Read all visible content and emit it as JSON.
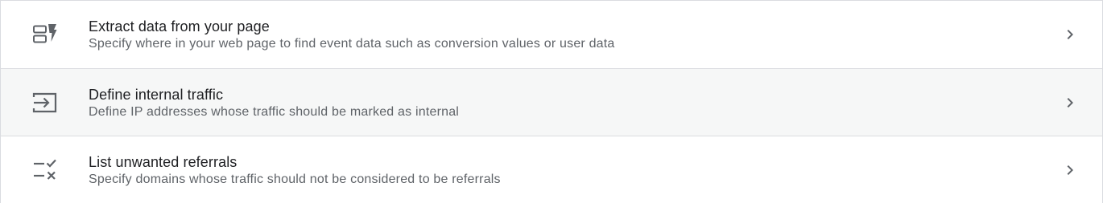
{
  "colors": {
    "border": "#dadce0",
    "row_hover_bg": "#f6f7f7",
    "title_text": "#202124",
    "description_text": "#5f6368",
    "icon": "#5f6368"
  },
  "rows": [
    {
      "title": "Extract data from your page",
      "description": "Specify where in your web page to find event data such as conversion values or user data",
      "icon": "extract-data-icon",
      "action_icon": "chevron-right-icon",
      "hovered": false
    },
    {
      "title": "Define internal traffic",
      "description": "Define IP addresses whose traffic should be marked as internal",
      "icon": "login-arrow-icon",
      "action_icon": "chevron-right-icon",
      "hovered": true
    },
    {
      "title": "List unwanted referrals",
      "description": "Specify domains whose traffic should not be considered to be referrals",
      "icon": "rule-check-icon",
      "action_icon": "chevron-right-icon",
      "hovered": false
    }
  ]
}
